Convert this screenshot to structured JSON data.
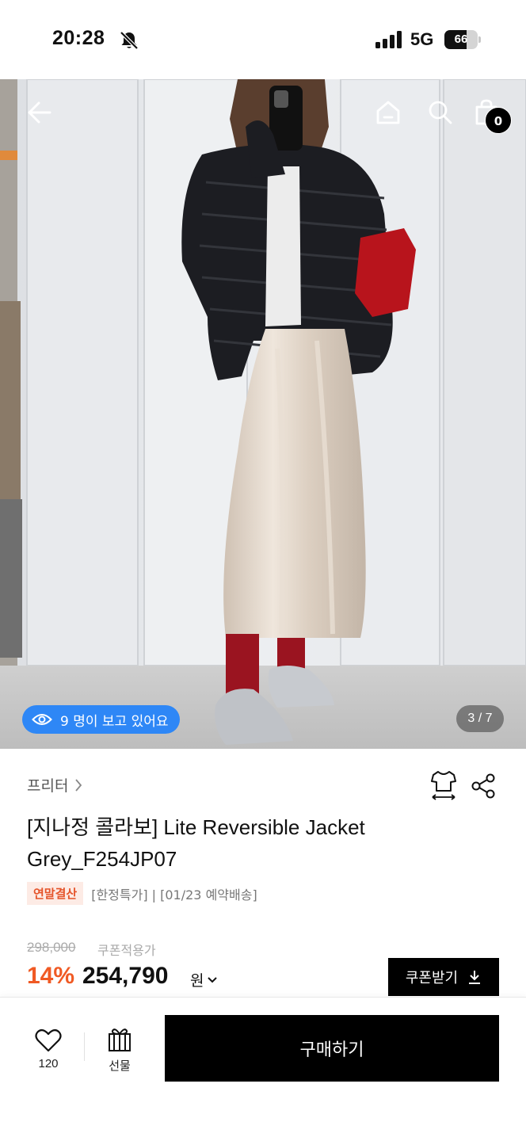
{
  "status_bar": {
    "time": "20:28",
    "network": "5G",
    "battery_level": 66,
    "battery_label": "66"
  },
  "top_nav": {
    "back_icon": "arrow-left-icon",
    "home_icon": "home-icon",
    "search_icon": "search-icon",
    "cart_icon": "shopping-bag-icon",
    "cart_count": "0"
  },
  "gallery": {
    "viewers_text": "9 명이 보고 있어요",
    "page_indicator": "3 / 7",
    "current_image": 3,
    "total_images": 7
  },
  "product": {
    "brand": "프리터",
    "title": "[지나정 콜라보] Lite Reversible Jacket Grey_F254JP07",
    "badge": "연말결산",
    "tags_text": "[한정특가] | [01/23 예약배송]",
    "original_price": "298,000",
    "coupon_note": "쿠폰적용가",
    "discount": "14%",
    "price": "254,790",
    "currency": "원",
    "coupon_button": "쿠폰받기"
  },
  "bottom_bar": {
    "like_count": "120",
    "gift_label": "선물",
    "buy_label": "구매하기"
  },
  "colors": {
    "discount_red": "#f05a24",
    "viewer_blue": "#2e87f6",
    "badge_bg": "#fdebe5"
  }
}
